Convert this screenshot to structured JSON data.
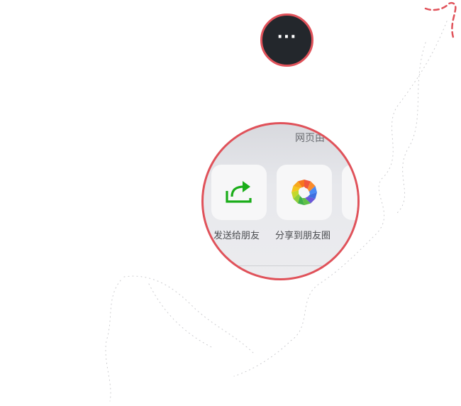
{
  "colors": {
    "highlight_ring": "#e0525a",
    "more_button_bg": "#23272c",
    "sheet_bg": "#e7e8ec",
    "tile_bg": "#f7f7f8",
    "share_green": "#1aad19"
  },
  "more_button": {
    "glyph": "···",
    "icon": "more-dots-icon"
  },
  "share_sheet": {
    "title_partial": "网页由",
    "actions": [
      {
        "label": "发送给朋友",
        "icon": "share-arrow-icon"
      },
      {
        "label": "分享到朋友圈",
        "icon": "moments-aperture-icon"
      }
    ]
  }
}
